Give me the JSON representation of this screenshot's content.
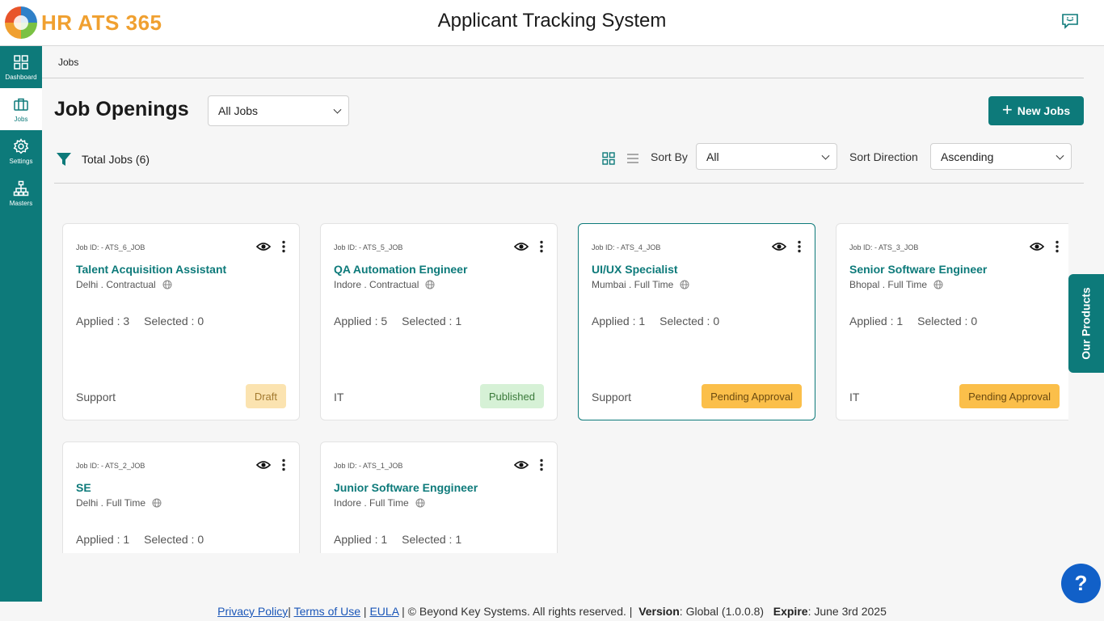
{
  "header": {
    "logo_text": "HR ATS 365",
    "app_title": "Applicant Tracking System"
  },
  "sidebar": {
    "items": [
      {
        "label": "Dashboard",
        "icon": "dashboard-icon"
      },
      {
        "label": "Jobs",
        "icon": "briefcase-icon",
        "active": true
      },
      {
        "label": "Settings",
        "icon": "gear-icon"
      },
      {
        "label": "Masters",
        "icon": "hierarchy-icon"
      }
    ]
  },
  "breadcrumb": "Jobs",
  "main": {
    "title": "Job Openings",
    "jobs_filter": "All Jobs",
    "new_button": "New Jobs",
    "total_jobs": "Total Jobs (6)",
    "sort_by_label": "Sort By",
    "sort_by_value": "All",
    "sort_direction_label": "Sort Direction",
    "sort_direction_value": "Ascending"
  },
  "jobs": [
    {
      "id": "Job ID: - ATS_6_JOB",
      "title": "Talent Acquisition Assistant",
      "location": "Delhi . Contractual",
      "applied": "Applied : 3",
      "selected": "Selected : 0",
      "dept": "Support",
      "status": "Draft"
    },
    {
      "id": "Job ID: - ATS_5_JOB",
      "title": "QA Automation Engineer",
      "location": "Indore . Contractual",
      "applied": "Applied : 5",
      "selected": "Selected : 1",
      "dept": "IT",
      "status": "Published"
    },
    {
      "id": "Job ID: - ATS_4_JOB",
      "title": "UI/UX Specialist",
      "location": "Mumbai . Full Time",
      "applied": "Applied : 1",
      "selected": "Selected : 0",
      "dept": "Support",
      "status": "Pending Approval"
    },
    {
      "id": "Job ID: - ATS_3_JOB",
      "title": "Senior Software Engineer",
      "location": "Bhopal . Full Time",
      "applied": "Applied : 1",
      "selected": "Selected : 0",
      "dept": "IT",
      "status": "Pending Approval"
    },
    {
      "id": "Job ID: - ATS_2_JOB",
      "title": "SE",
      "location": "Delhi . Full Time",
      "applied": "Applied : 1",
      "selected": "Selected : 0",
      "dept": "",
      "status": ""
    },
    {
      "id": "Job ID: - ATS_1_JOB",
      "title": "Junior Software Enggineer",
      "location": "Indore . Full Time",
      "applied": "Applied : 1",
      "selected": "Selected : 1",
      "dept": "",
      "status": ""
    }
  ],
  "side_tab": "Our Products",
  "help": "?",
  "footer": {
    "privacy": "Privacy Policy",
    "sep1": "|",
    "terms": "Terms of Use",
    "sep2": "|",
    "eula": "EULA",
    "copyright": "| © Beyond Key Systems. All rights reserved. |",
    "version_label": "Version",
    "version_value": ": Global (1.0.0.8)",
    "expire_label": "Expire",
    "expire_value": ": June 3rd 2025"
  },
  "colors": {
    "brand": "#0d7a7a",
    "logo": "#f0a030",
    "link": "#1a56b8",
    "help": "#1160c8"
  }
}
